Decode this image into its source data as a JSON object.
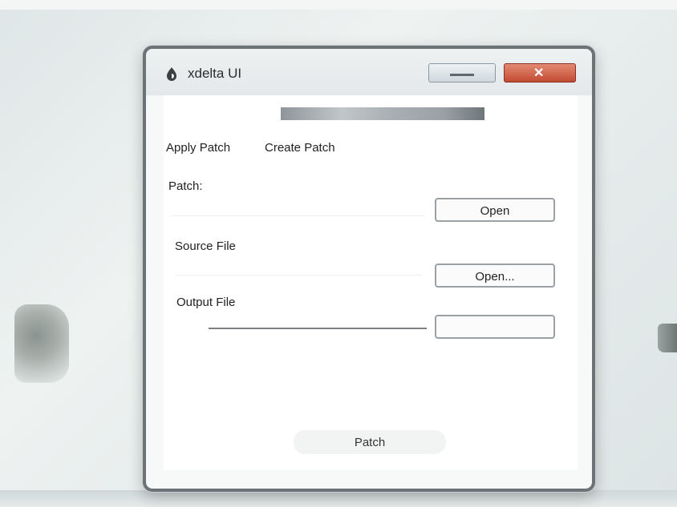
{
  "window": {
    "title": "xdelta UI",
    "app_icon": "app-icon",
    "minimize_icon": "minimize-icon",
    "close_icon": "close-icon"
  },
  "banner": {
    "text": ""
  },
  "tabs": [
    {
      "label": "Apply Patch"
    },
    {
      "label": "Create Patch"
    }
  ],
  "fields": {
    "patch": {
      "label": "Patch:",
      "value": ""
    },
    "source": {
      "label": "Source File",
      "value": ""
    },
    "output": {
      "label": "Output File",
      "value": ""
    }
  },
  "buttons": {
    "open_patch": "Open",
    "open_source": "Open...",
    "open_output": "",
    "patch": "Patch"
  }
}
